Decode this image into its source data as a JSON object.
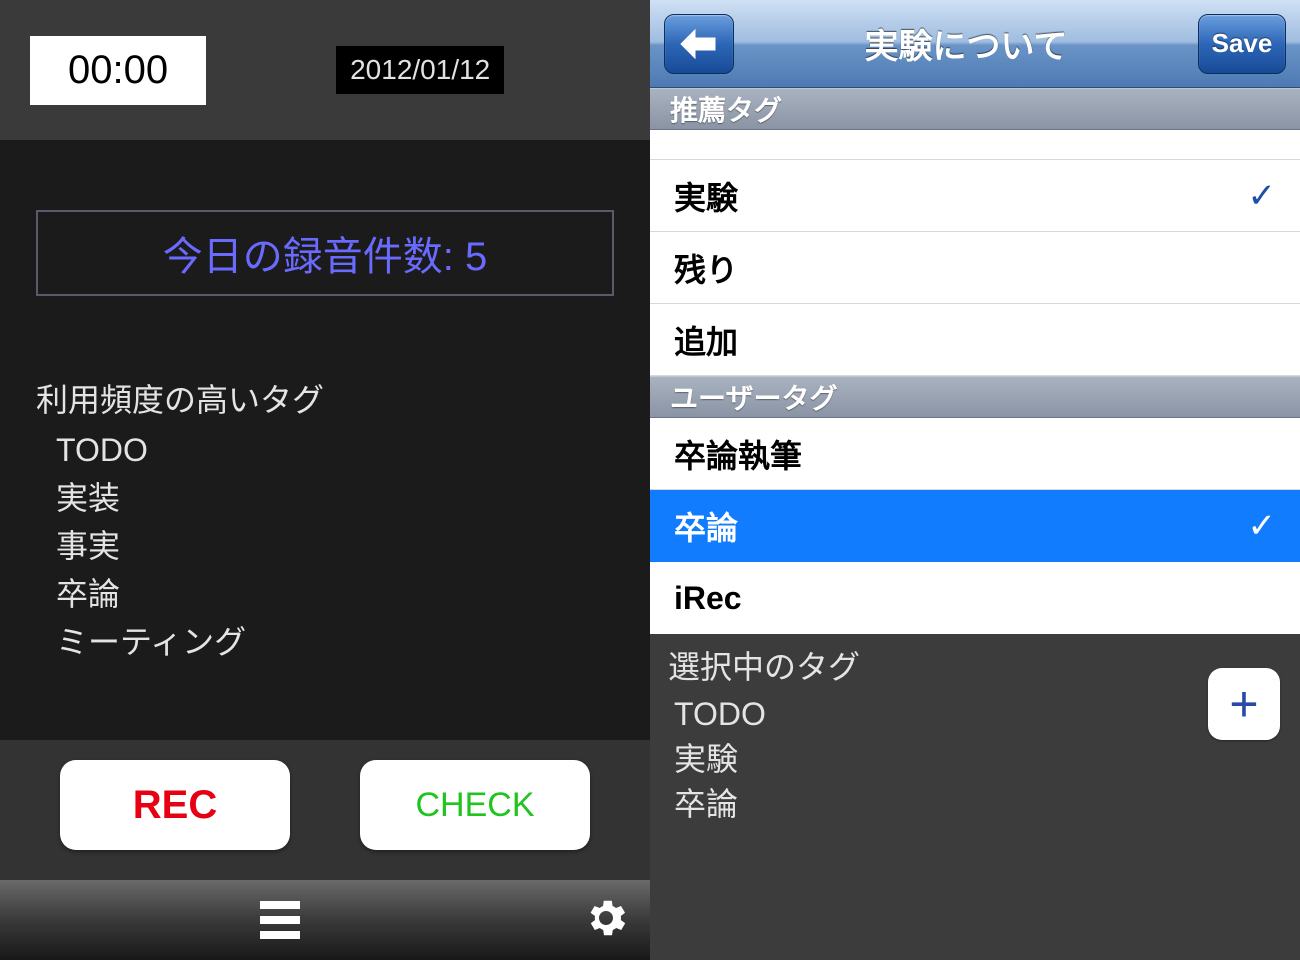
{
  "left": {
    "timer": "00:00",
    "date": "2012/01/12",
    "count_label": "今日の録音件数: 5",
    "freq_title": "利用頻度の高いタグ",
    "freq_tags": [
      "TODO",
      "実装",
      "事実",
      "卒論",
      "ミーティング"
    ],
    "rec_button": "REC",
    "check_button": "CHECK"
  },
  "right": {
    "nav_title": "実験について",
    "save": "Save",
    "section_recommended": "推薦タグ",
    "section_user": "ユーザータグ",
    "rows_recommended": [
      {
        "label": "実験",
        "checked": true
      },
      {
        "label": "残り",
        "checked": false
      },
      {
        "label": "追加",
        "checked": false
      }
    ],
    "rows_user": [
      {
        "label": "卒論執筆",
        "checked": false,
        "selected": false
      },
      {
        "label": "卒論",
        "checked": true,
        "selected": true
      },
      {
        "label": "iRec",
        "checked": false,
        "selected": false
      }
    ],
    "selected_title": "選択中のタグ",
    "selected_tags": [
      "TODO",
      "実験",
      "卒論"
    ],
    "plus": "+"
  }
}
